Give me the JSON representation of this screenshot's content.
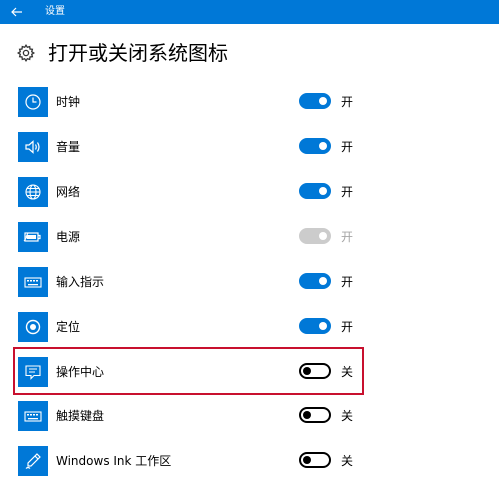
{
  "window": {
    "title": "设置"
  },
  "page": {
    "title": "打开或关闭系统图标"
  },
  "colors": {
    "accent": "#0078d7",
    "highlight": "#c8102e",
    "disabled": "#cccccc"
  },
  "items": [
    {
      "label": "时钟",
      "icon": "clock-icon",
      "on": true,
      "state": "开"
    },
    {
      "label": "音量",
      "icon": "volume-icon",
      "on": true,
      "state": "开"
    },
    {
      "label": "网络",
      "icon": "network-globe-icon",
      "on": true,
      "state": "开"
    },
    {
      "label": "电源",
      "icon": "battery-power-icon",
      "on": true,
      "disabled": true,
      "state": "开"
    },
    {
      "label": "输入指示",
      "icon": "keyboard-icon",
      "on": true,
      "state": "开"
    },
    {
      "label": "定位",
      "icon": "location-icon",
      "on": true,
      "state": "开"
    },
    {
      "label": "操作中心",
      "icon": "action-center-icon",
      "on": false,
      "state": "关",
      "highlighted": true
    },
    {
      "label": "触摸键盘",
      "icon": "touch-keyboard-icon",
      "on": false,
      "state": "关"
    },
    {
      "label": "Windows Ink 工作区",
      "icon": "windows-ink-pen-icon",
      "on": false,
      "state": "关"
    }
  ]
}
